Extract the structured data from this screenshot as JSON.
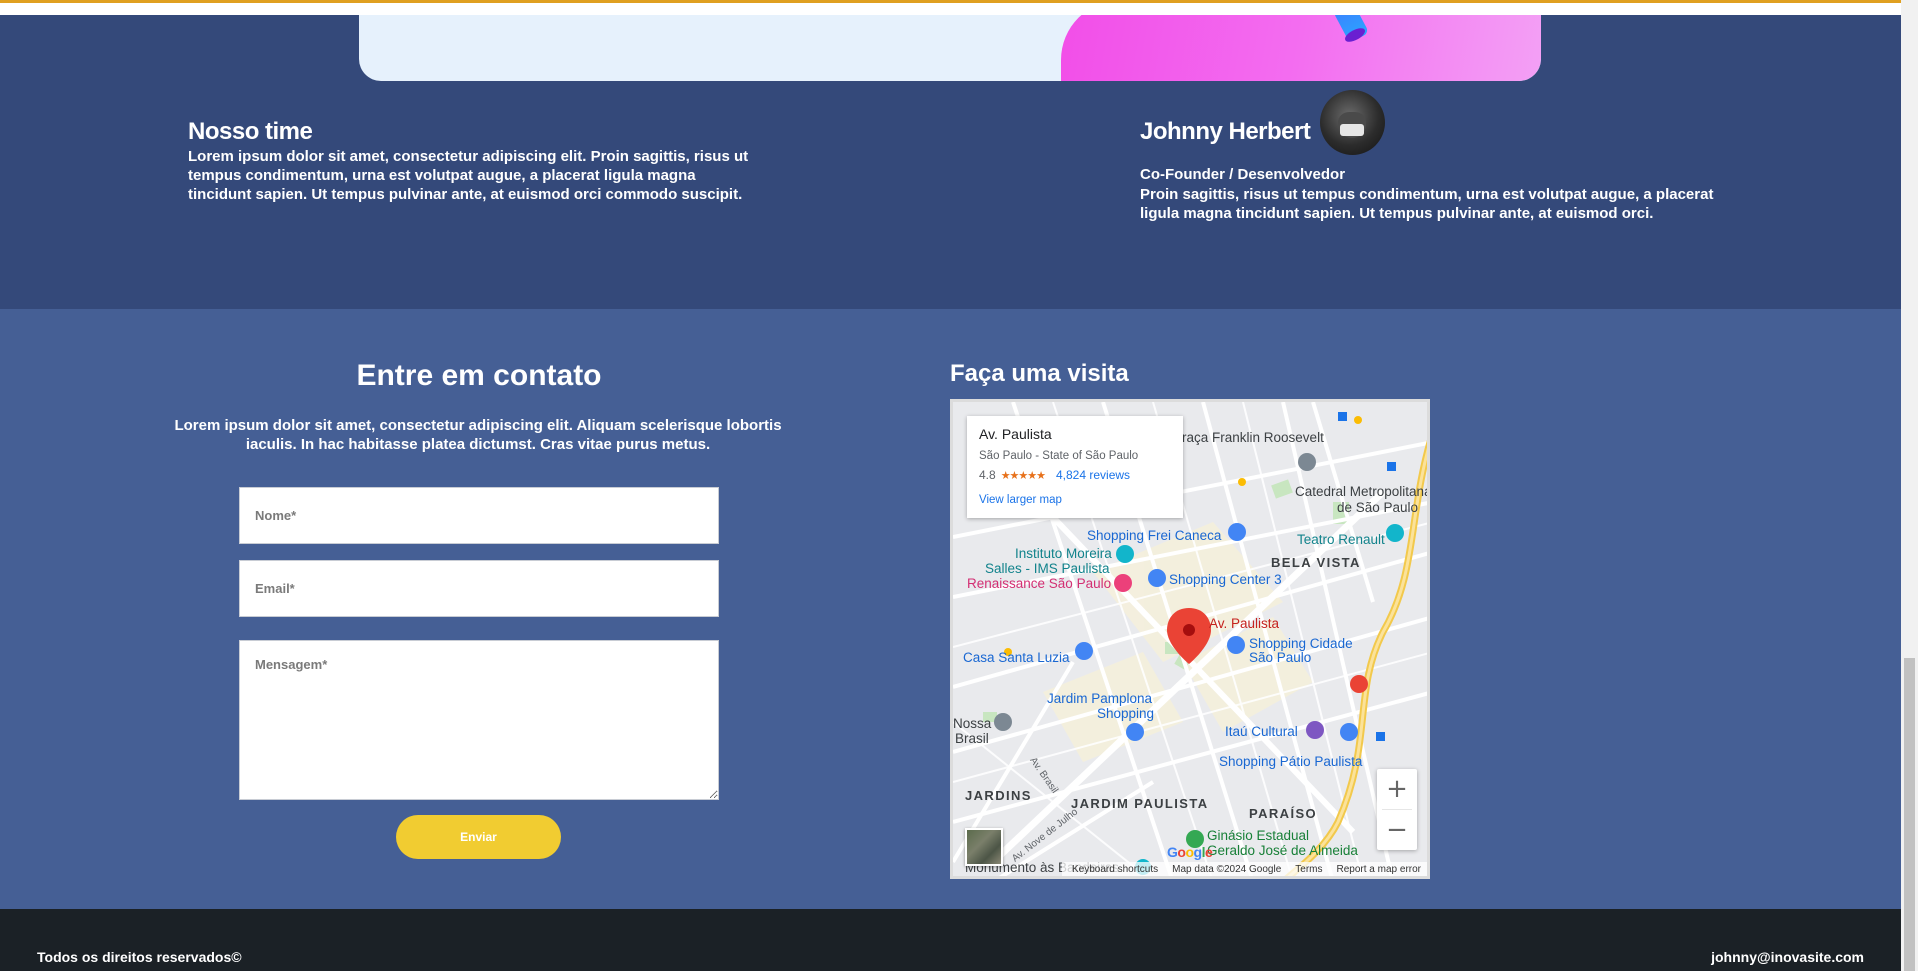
{
  "team": {
    "title": "Nosso time",
    "text": "Lorem ipsum dolor sit amet, consectetur adipiscing elit. Proin sagittis, risus ut tempus condimentum, urna est volutpat augue, a placerat ligula magna tincidunt sapien. Ut tempus pulvinar ante, at euismod orci commodo suscipit.",
    "member": {
      "name": "Johnny Herbert",
      "role": "Co-Founder / Desenvolvedor",
      "bio": "Proin sagittis, risus ut tempus condimentum, urna est volutpat augue, a placerat ligula magna tincidunt sapien. Ut tempus pulvinar ante, at euismod orci."
    },
    "social_icons": [
      "facebook-icon",
      "twitter-icon",
      "instagram-icon"
    ]
  },
  "contact": {
    "title": "Entre em contato",
    "text": "Lorem ipsum dolor sit amet, consectetur adipiscing elit. Aliquam scelerisque lobortis iaculis. In hac habitasse platea dictumst. Cras vitae purus metus.",
    "name_placeholder": "Nome*",
    "email_placeholder": "Email*",
    "message_placeholder": "Mensagem*",
    "send_label": "Enviar"
  },
  "visit": {
    "title": "Faça uma visita"
  },
  "map": {
    "place_name": "Av. Paulista",
    "place_address": "São Paulo - State of São Paulo",
    "rating": "4.8",
    "stars": "★★★★★",
    "reviews": "4,824 reviews",
    "larger_map": "View larger map",
    "pin_label": "Av. Paulista",
    "labels": {
      "praca": "Praça Franklin Roosevelt",
      "catedral_1": "Catedral Metropolitana",
      "catedral_2": "de São Paulo",
      "frei_caneca": "Shopping Frei Caneca",
      "teatro": "Teatro Renault",
      "moreira_1": "Instituto Moreira",
      "moreira_2": "Salles - IMS Paulista",
      "bela_vista": "BELA VISTA",
      "renaissance": "Renaissance São Paulo",
      "center3": "Shopping Center 3",
      "cidade_1": "Shopping Cidade",
      "cidade_2": "São Paulo",
      "santa_luzia": "Casa Santa Luzia",
      "pamplona_1": "Jardim Pamplona",
      "pamplona_2": "Shopping",
      "nossa_1": "Nossa",
      "nossa_2": "Brasil",
      "brasil_ave": "Av. Brasil",
      "itau": "Itaú Cultural",
      "patio": "Shopping Pátio Paulista",
      "jardins": "JARDINS",
      "jardim_paulista": "JARDIM PAULISTA",
      "paraiso": "PARAÍSO",
      "nove_julho": "Av. Nove de Julho",
      "ginasio_1": "Ginásio Estadual",
      "ginasio_2": "Geraldo José de Almeida",
      "monumento": "Monumento às Bandeiras"
    },
    "google": "Google",
    "footer": {
      "shortcuts": "Keyboard shortcuts",
      "data": "Map data ©2024 Google",
      "terms": "Terms",
      "report": "Report a map error"
    },
    "zoom_in": "+",
    "zoom_out": "−"
  },
  "footer": {
    "rights": "Todos os direitos reservados©",
    "email": "johnny@inovasite.com"
  },
  "colors": {
    "team_bg": "#34497a",
    "contact_bg": "#455f95",
    "footer_bg": "#1b2126",
    "button": "#f1cc31"
  }
}
